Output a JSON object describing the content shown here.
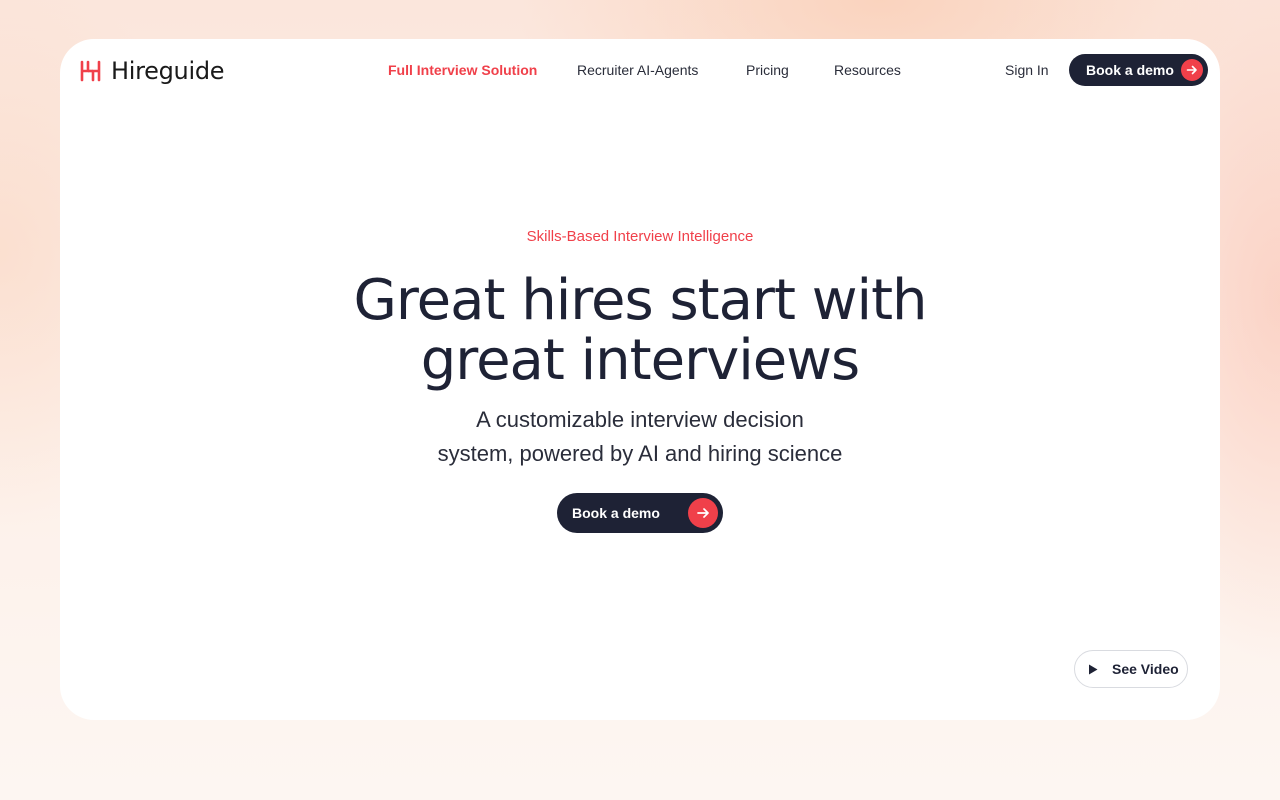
{
  "brand": {
    "name": "Hireguide",
    "accent_color": "#f0404a",
    "dark_color": "#1e2235",
    "logo_icon": "hireguide-logo-icon"
  },
  "nav": {
    "items": [
      {
        "label": "Full Interview Solution",
        "active": true
      },
      {
        "label": "Recruiter AI-Agents",
        "active": false
      },
      {
        "label": "Pricing",
        "active": false
      },
      {
        "label": "Resources",
        "active": false
      }
    ],
    "sign_in": "Sign In",
    "cta": "Book a demo",
    "cta_icon": "arrow-right-icon"
  },
  "hero": {
    "eyebrow": "Skills-Based Interview Intelligence",
    "headline": [
      "Great hires start with",
      "great interviews"
    ],
    "subhead": [
      "A customizable interview decision",
      "system, powered by AI and hiring science"
    ],
    "cta": "Book a demo",
    "cta_icon": "arrow-right-icon"
  },
  "video": {
    "label": "See Video",
    "icon": "play-icon"
  }
}
